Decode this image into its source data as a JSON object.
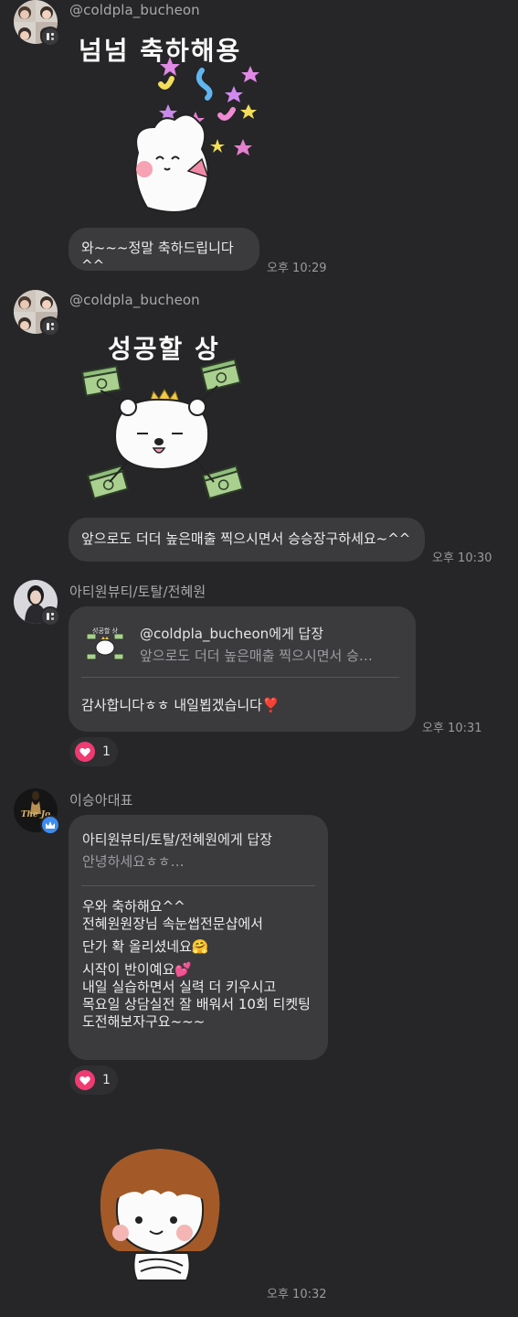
{
  "messages": [
    {
      "sender": "@coldpla_bucheon",
      "sticker_text": "넘넘 축하해용",
      "text": "와~~~정말 축하드립니다^^",
      "time": "오후 10:29"
    },
    {
      "sender": "@coldpla_bucheon",
      "sticker_text": "성공할 상",
      "text": "앞으로도 더더 높은매출 찍으시면서 승승장구하세요~^^",
      "time": "오후 10:30"
    },
    {
      "sender": "아티원뷰티/토탈/전혜원",
      "reply_to": "@coldpla_bucheon에게 답장",
      "reply_preview": "앞으로도 더더 높은매출 찍으시면서 승…",
      "reply_thumb_text": "성공할 상",
      "text": "감사합니다ㅎㅎ 내일뵙겠습니다❣️",
      "time": "오후 10:31",
      "reaction_count": "1"
    },
    {
      "sender": "이승아대표",
      "avatar_text": "The Jo",
      "reply_to": "아티원뷰티/토탈/전혜원에게 답장",
      "reply_preview": "안녕하세요ㅎㅎ…",
      "lines": [
        "우와 축하해요^^",
        "전혜원원장님 속눈썹전문샵에서",
        "단가 확 올리셨네요🤗",
        "시작이 반이예요💕",
        "내일 실습하면서 실력 더 키우시고",
        "목요일 상담실전 잘 배워서 10회 티켓팅",
        "도전해보자구요~~~"
      ],
      "reaction_count": "1"
    },
    {
      "time": "오후 10:32"
    }
  ],
  "icons": {
    "badge": "server-badge-icon",
    "crown": "crown-badge-icon",
    "heart": "heart-icon"
  },
  "colors": {
    "background": "#262628",
    "bubble": "#3b3b3e",
    "heart": "#f03a72",
    "crown_badge": "#3d8cf0"
  }
}
